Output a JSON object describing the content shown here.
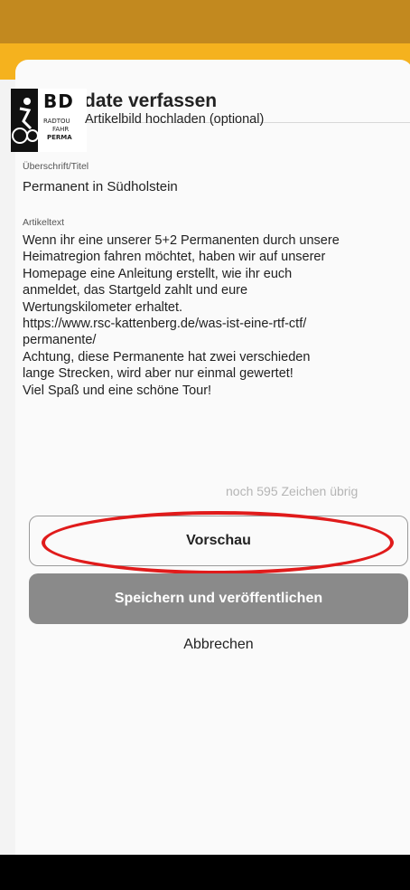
{
  "header": {
    "title": "Update verfassen",
    "back_icon": "arrow-left-icon"
  },
  "image_upload": {
    "label": "Artikelbild hochladen (optional)",
    "thumbnail": {
      "logo_text": "BD",
      "line1": "RADTOU",
      "line2": "FAHR",
      "line3": "PERMA"
    }
  },
  "fields": {
    "title_label": "Überschrift/Titel",
    "title_value": "Permanent in Südholstein",
    "text_label": "Artikeltext",
    "text_lines": [
      "Wenn ihr eine unserer 5+2 Permanenten durch unsere",
      "Heimatregion fahren möchtet, haben wir auf unserer",
      "Homepage eine Anleitung erstellt, wie ihr euch",
      "anmeldet, das Startgeld zahlt und eure",
      "Wertungskilometer erhaltet.",
      "https://www.rsc-kattenberg.de/was-ist-eine-rtf-ctf/",
      "permanente/",
      "Achtung, diese Permanente hat zwei verschieden",
      "lange Strecken, wird aber nur einmal gewertet!",
      "Viel Spaß und eine schöne Tour!"
    ]
  },
  "counter": "noch 595 Zeichen übrig",
  "buttons": {
    "preview": "Vorschau",
    "publish": "Speichern und veröffentlichen",
    "cancel": "Abbrechen"
  },
  "colors": {
    "status_bar": "#c2891f",
    "app_bar": "#f5b21e",
    "publish_bg": "#8a8a8a",
    "highlight_ring": "#e01b1b"
  }
}
